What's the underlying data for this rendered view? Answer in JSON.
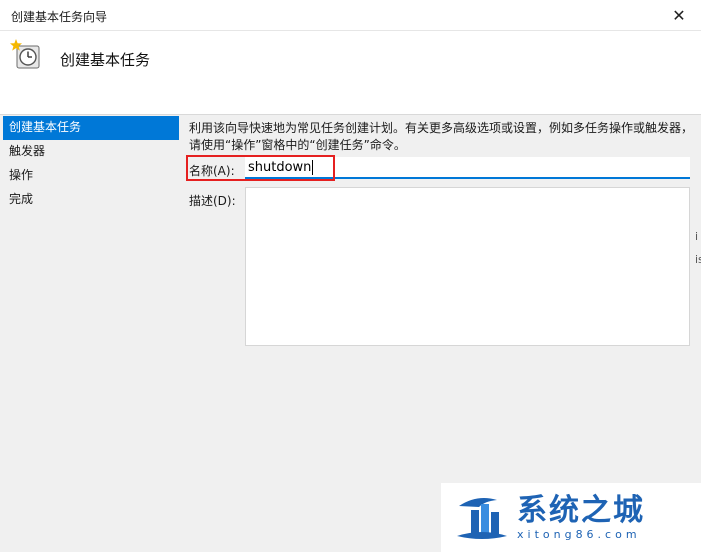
{
  "window": {
    "title": "创建基本任务向导",
    "close_glyph": "✕"
  },
  "header": {
    "title": "创建基本任务",
    "icon": "clock-star-icon"
  },
  "nav": {
    "items": [
      {
        "label": "创建基本任务",
        "active": true
      },
      {
        "label": "触发器",
        "active": false
      },
      {
        "label": "操作",
        "active": false
      },
      {
        "label": "完成",
        "active": false
      }
    ]
  },
  "main": {
    "description": "利用该向导快速地为常见任务创建计划。有关更多高级选项或设置，例如多任务操作或触发器，请使用“操作”窗格中的“创建任务”命令。",
    "name_label": "名称(A):",
    "name_value": "shutdown",
    "desc_label": "描述(D):",
    "desc_value": ""
  },
  "watermark": {
    "title": "系统之城",
    "subtitle": "xitong86.com"
  },
  "colors": {
    "accent": "#0078d7",
    "highlight_box": "#e52020",
    "watermark": "#1e63b4"
  }
}
